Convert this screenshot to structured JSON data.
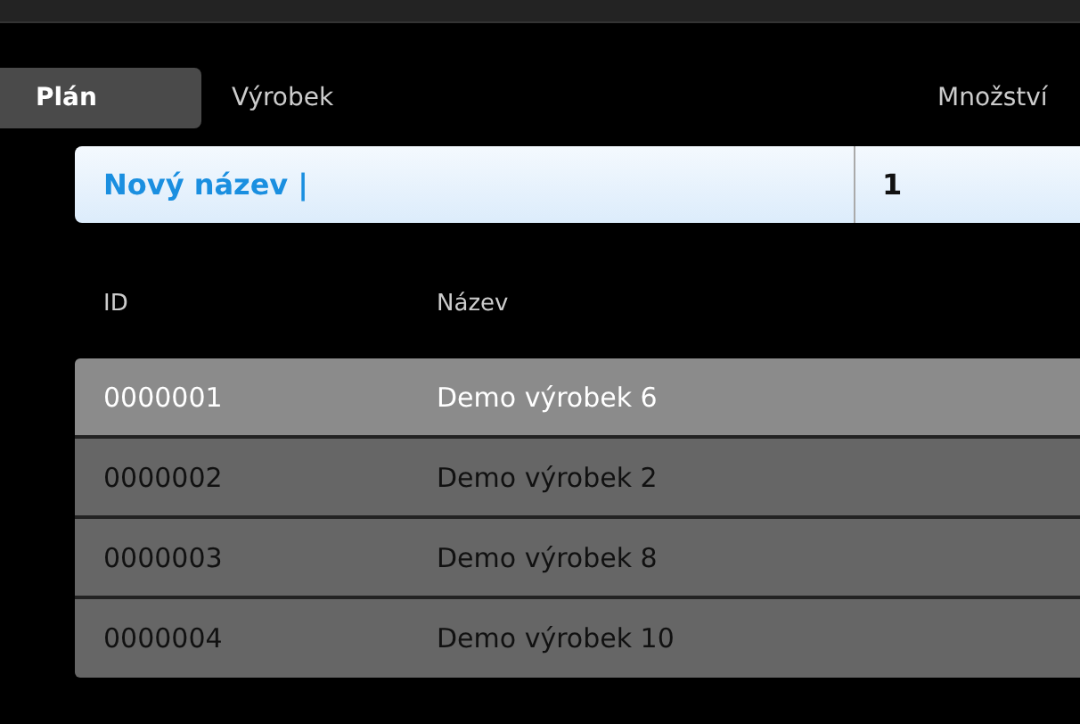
{
  "tabs": [
    {
      "label": "Plán",
      "selected": true
    },
    {
      "label": "Výrobek",
      "selected": false
    }
  ],
  "quantity_label": "Množství",
  "name_field": {
    "value": "Nový název |"
  },
  "quantity_field": {
    "value": "1"
  },
  "table": {
    "columns": [
      "ID",
      "Název"
    ],
    "rows": [
      {
        "id": "0000001",
        "name": "Demo výrobek 6",
        "selected": true
      },
      {
        "id": "0000002",
        "name": "Demo výrobek 2",
        "selected": false
      },
      {
        "id": "0000003",
        "name": "Demo výrobek 8",
        "selected": false
      },
      {
        "id": "0000004",
        "name": "Demo výrobek 10",
        "selected": false
      }
    ]
  }
}
